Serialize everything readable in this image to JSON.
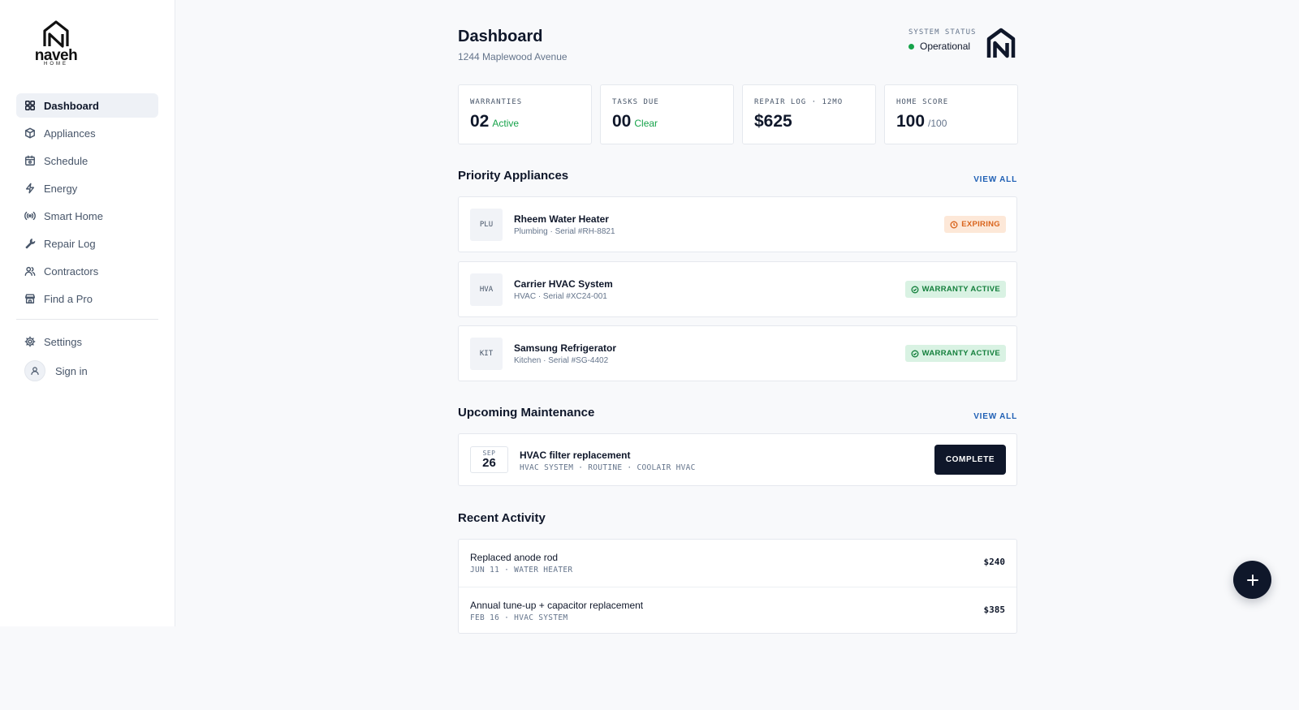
{
  "brand": {
    "name": "naveh",
    "tagline": "HOME"
  },
  "sidebar": {
    "items": [
      {
        "label": "Dashboard",
        "icon": "grid-icon",
        "active": true
      },
      {
        "label": "Appliances",
        "icon": "cube-icon"
      },
      {
        "label": "Schedule",
        "icon": "calendar-icon"
      },
      {
        "label": "Energy",
        "icon": "bolt-icon"
      },
      {
        "label": "Smart Home",
        "icon": "broadcast-icon"
      },
      {
        "label": "Repair Log",
        "icon": "wrench-icon"
      },
      {
        "label": "Contractors",
        "icon": "users-icon"
      },
      {
        "label": "Find a Pro",
        "icon": "store-icon"
      }
    ],
    "settings": "Settings",
    "signin": "Sign in"
  },
  "header": {
    "title": "Dashboard",
    "address": "1244 Maplewood Avenue",
    "status_label": "SYSTEM STATUS",
    "status_value": "Operational"
  },
  "stats": [
    {
      "label": "WARRANTIES",
      "value": "02",
      "suffix": "Active"
    },
    {
      "label": "TASKS DUE",
      "value": "00",
      "suffix": "Clear"
    },
    {
      "label": "REPAIR LOG · 12MO",
      "value": "$625",
      "suffix": ""
    },
    {
      "label": "HOME SCORE",
      "value": "100",
      "suffix": "/100"
    }
  ],
  "priority": {
    "title": "Priority Appliances",
    "view_all": "VIEW ALL",
    "items": [
      {
        "tag": "PLU",
        "name": "Rheem Water Heater",
        "sub": "Plumbing · Serial #RH-8821",
        "badge": "EXPIRING"
      },
      {
        "tag": "HVA",
        "name": "Carrier HVAC System",
        "sub": "HVAC · Serial #XC24-001",
        "badge": "WARRANTY ACTIVE"
      },
      {
        "tag": "KIT",
        "name": "Samsung Refrigerator",
        "sub": "Kitchen · Serial #SG-4402",
        "badge": "WARRANTY ACTIVE"
      }
    ]
  },
  "maintenance": {
    "title": "Upcoming Maintenance",
    "view_all": "VIEW ALL",
    "items": [
      {
        "month": "SEP",
        "day": "26",
        "title": "HVAC filter replacement",
        "sub": "HVAC SYSTEM · ROUTINE · COOLAIR HVAC",
        "action": "COMPLETE"
      }
    ]
  },
  "activity": {
    "title": "Recent Activity",
    "items": [
      {
        "title": "Replaced anode rod",
        "sub": "JUN 11 · WATER HEATER",
        "amount": "$240"
      },
      {
        "title": "Annual tune-up + capacitor replacement",
        "sub": "FEB 16 · HVAC SYSTEM",
        "amount": "$385"
      }
    ]
  },
  "colors": {
    "accent": "#0f172a",
    "link": "#1e5fb4",
    "success": "#16a34a",
    "warning": "#d9641c"
  }
}
